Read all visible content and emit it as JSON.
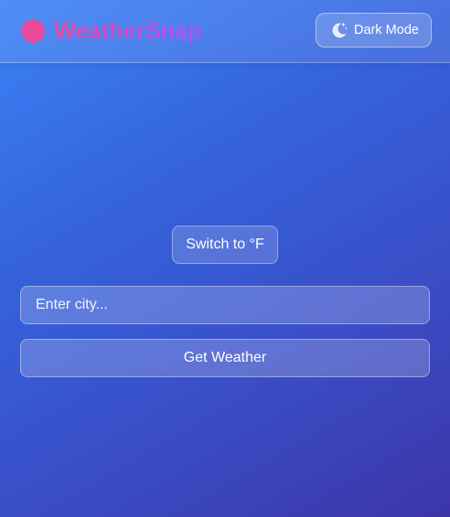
{
  "app": {
    "title": "WeatherSnap",
    "logo_icon": "sun-flower-icon",
    "title_gradient": [
      "#ec4899",
      "#a855f7"
    ]
  },
  "header": {
    "theme_toggle": {
      "label": "Dark Mode",
      "icon": "moon-stars-icon"
    }
  },
  "main": {
    "unit_toggle_label": "Switch to °F",
    "search": {
      "value": "",
      "placeholder": "Enter city..."
    },
    "submit_label": "Get Weather"
  },
  "theme": {
    "background_start": "#3b82f6",
    "background_end": "#3c35a8",
    "text": "#ffffff"
  }
}
